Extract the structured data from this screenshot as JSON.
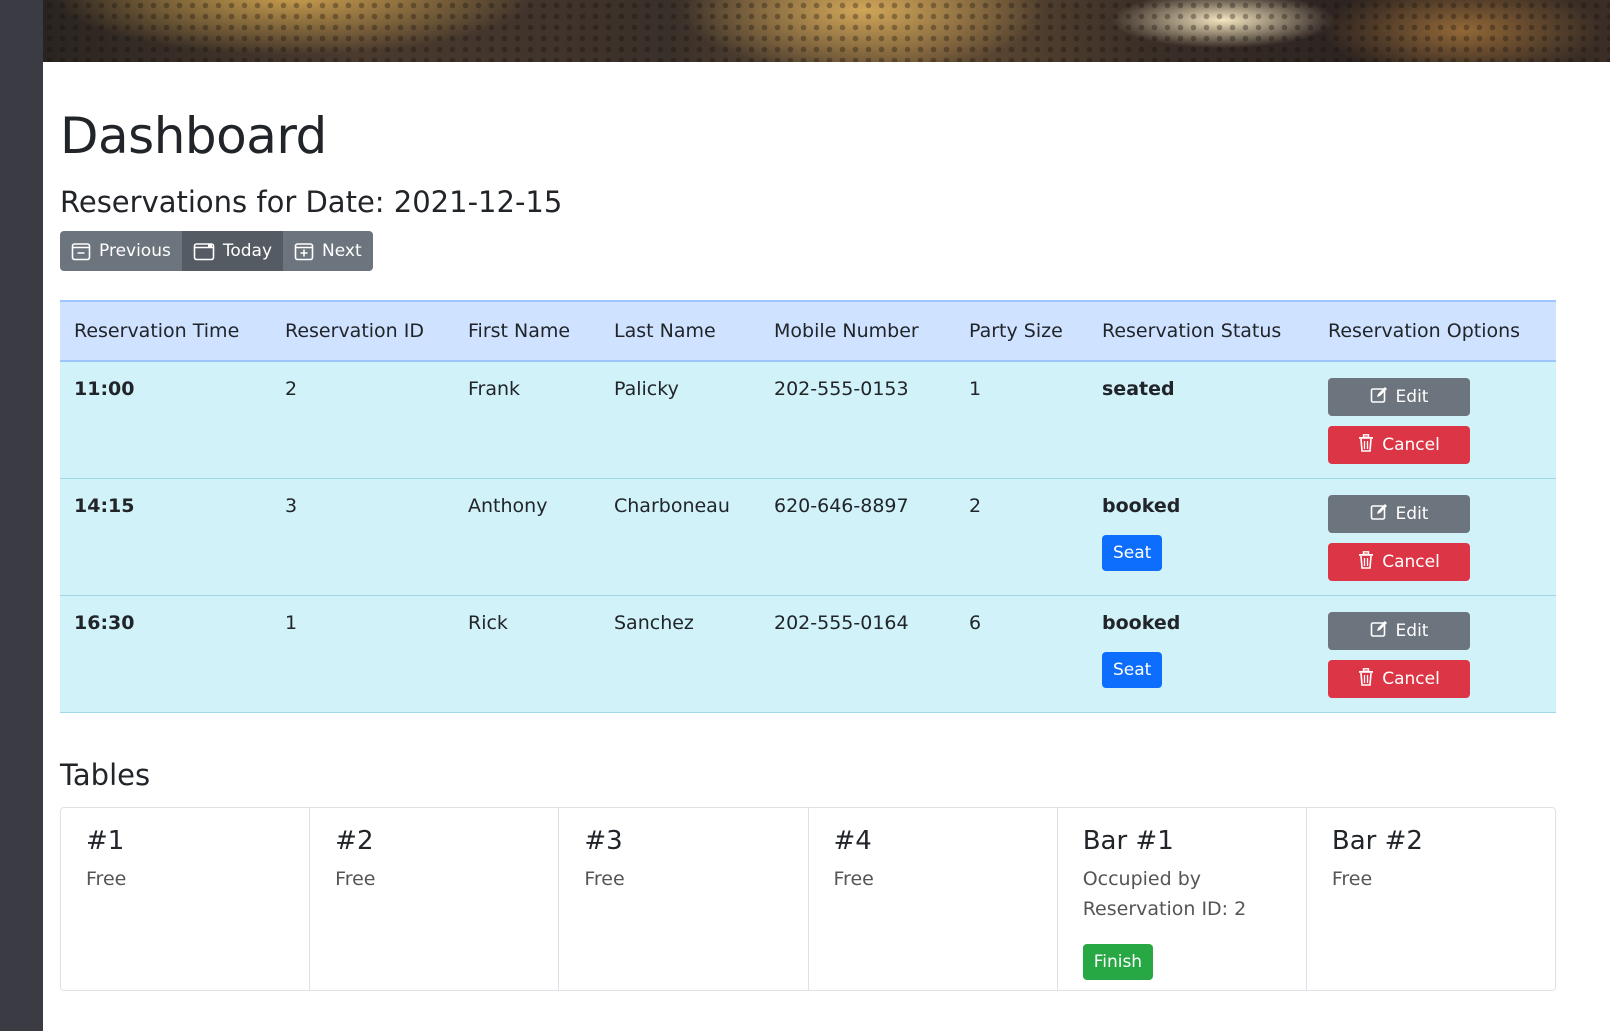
{
  "header": {
    "title": "Dashboard",
    "date_heading": "Reservations for Date: 2021-12-15"
  },
  "date_nav": {
    "previous": "Previous",
    "today": "Today",
    "next": "Next"
  },
  "reservations": {
    "columns": [
      "Reservation Time",
      "Reservation ID",
      "First Name",
      "Last Name",
      "Mobile Number",
      "Party Size",
      "Reservation Status",
      "Reservation Options"
    ],
    "rows": [
      {
        "time": "11:00",
        "id": "2",
        "first": "Frank",
        "last": "Palicky",
        "mobile": "202-555-0153",
        "party": "1",
        "status": "seated",
        "show_seat": false
      },
      {
        "time": "14:15",
        "id": "3",
        "first": "Anthony",
        "last": "Charboneau",
        "mobile": "620-646-8897",
        "party": "2",
        "status": "booked",
        "show_seat": true
      },
      {
        "time": "16:30",
        "id": "1",
        "first": "Rick",
        "last": "Sanchez",
        "mobile": "202-555-0164",
        "party": "6",
        "status": "booked",
        "show_seat": true
      }
    ],
    "seat_label": "Seat",
    "edit_label": "Edit",
    "cancel_label": "Cancel"
  },
  "tables": {
    "heading": "Tables",
    "items": [
      {
        "name": "#1",
        "status": "Free"
      },
      {
        "name": "#2",
        "status": "Free"
      },
      {
        "name": "#3",
        "status": "Free"
      },
      {
        "name": "#4",
        "status": "Free"
      },
      {
        "name": "Bar #1",
        "status": "Occupied by Reservation ID: 2",
        "finish": "Finish"
      },
      {
        "name": "Bar #2",
        "status": "Free"
      }
    ]
  },
  "colors": {
    "primary": "#0d6efd",
    "danger": "#dc3545",
    "secondary": "#6c757d",
    "success": "#28a745",
    "table_header": "#cfe2ff",
    "table_row": "#d1f2f9",
    "sidebar": "#3b3b44"
  }
}
